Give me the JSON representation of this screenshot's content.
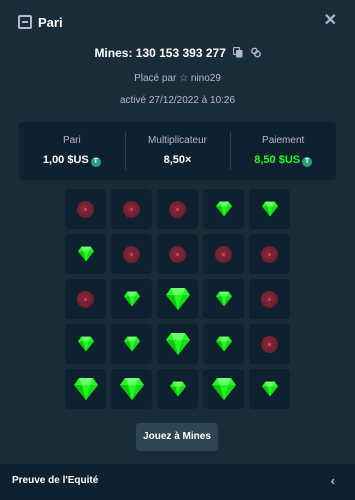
{
  "header": {
    "title": "Pari",
    "icon": "bet-slip-icon",
    "close_icon": "close-icon"
  },
  "bet": {
    "mines_id": "Mines: 130 153 393 277",
    "placed_by_label": "Placé par",
    "username": "nino29",
    "active_label": "activé 27/12/2022 à 10:26"
  },
  "stats": {
    "bet_label": "Pari",
    "bet_value": "1,00 $US",
    "multiplier_label": "Multiplicateur",
    "multiplier_value": "8,50×",
    "payout_label": "Paiement",
    "payout_value": "8,50 $US",
    "currency_icon": "tether-icon"
  },
  "board": {
    "tiles": [
      "mine",
      "mine",
      "mine",
      "gem",
      "gem",
      "gem",
      "mine",
      "mine",
      "mine",
      "mine",
      "mine",
      "gem",
      "gem-big",
      "gem",
      "mine",
      "gem",
      "gem",
      "gem-big",
      "gem",
      "mine",
      "gem-big",
      "gem-big",
      "gem",
      "gem-big",
      "gem"
    ]
  },
  "play_button": {
    "label": "Jouez à Mines"
  },
  "footer": {
    "label": "Preuve de l'Equité",
    "chevron_icon": "chevron-left-icon"
  },
  "colors": {
    "background": "#1a2c38",
    "panel": "#0f212e",
    "tile": "#0f212e",
    "gem": "#1fff20",
    "mine": "#6b1e2d",
    "button": "#2f4553",
    "muted_text": "#b1bad3"
  }
}
